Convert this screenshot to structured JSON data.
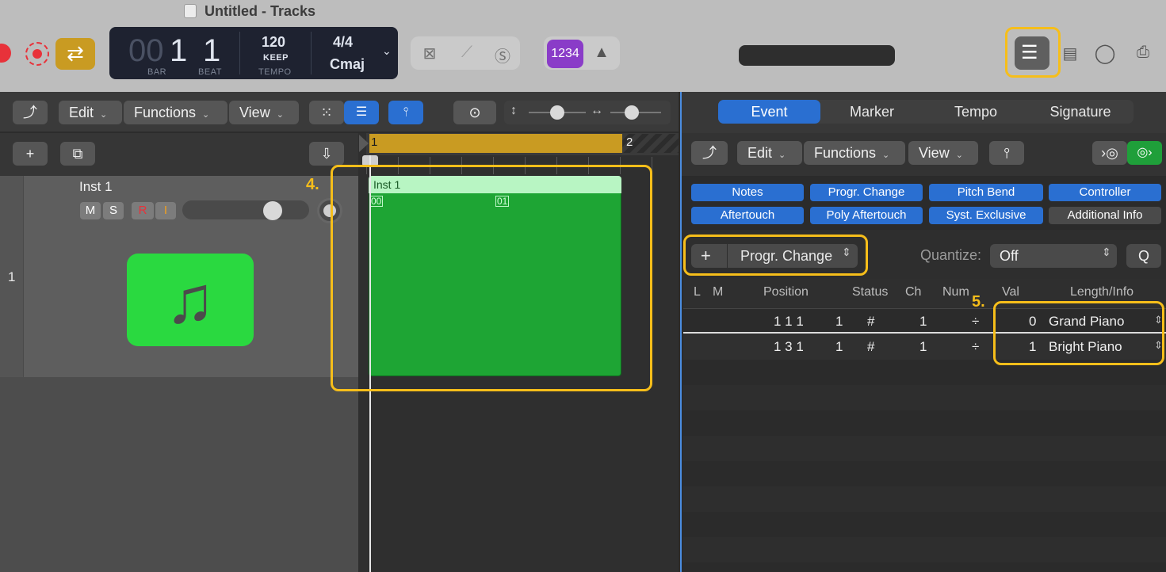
{
  "window": {
    "title": "Untitled - Tracks"
  },
  "lcd": {
    "bar_dim": "00",
    "bar": "1",
    "beat": "1",
    "bar_label": "BAR",
    "beat_label": "BEAT",
    "tempo": "120",
    "tempo_mode": "KEEP",
    "tempo_label": "TEMPO",
    "signature": "4/4",
    "key": "Cmaj"
  },
  "control_bar": {
    "count_in": "1234"
  },
  "annotations": {
    "step4": "4.",
    "step5": "5."
  },
  "left_toolbar": {
    "edit": "Edit",
    "functions": "Functions",
    "view": "View"
  },
  "track": {
    "number": "1",
    "name": "Inst 1",
    "mute": "M",
    "solo": "S",
    "record": "R",
    "input": "I"
  },
  "ruler": {
    "bar1": "1",
    "bar2": "2"
  },
  "region": {
    "name": "Inst 1",
    "event_a": "00",
    "event_b": "01"
  },
  "event_tabs": [
    "Event",
    "Marker",
    "Tempo",
    "Signature"
  ],
  "event_toolbar": {
    "edit": "Edit",
    "functions": "Functions",
    "view": "View"
  },
  "filters": [
    "Notes",
    "Progr. Change",
    "Pitch Bend",
    "Controller",
    "Aftertouch",
    "Poly Aftertouch",
    "Syst. Exclusive",
    "Additional Info"
  ],
  "create": {
    "type": "Progr. Change",
    "quantize_label": "Quantize:",
    "quantize_value": "Off",
    "q_button": "Q"
  },
  "columns": {
    "l": "L",
    "m": "M",
    "position": "Position",
    "status": "Status",
    "ch": "Ch",
    "num": "Num",
    "val": "Val",
    "length_info": "Length/Info"
  },
  "events": [
    {
      "position": "1 1 1",
      "tick": "1",
      "status": "#",
      "ch": "1",
      "num": "÷",
      "val": "0",
      "info": "Grand Piano"
    },
    {
      "position": "1 3 1",
      "tick": "1",
      "status": "#",
      "ch": "1",
      "num": "÷",
      "val": "1",
      "info": "Bright Piano"
    }
  ],
  "colors": {
    "accent_blue": "#2a6fd1",
    "highlight": "#f6be1a",
    "region_green": "#1ea534",
    "cycle_gold": "#c99b22"
  }
}
